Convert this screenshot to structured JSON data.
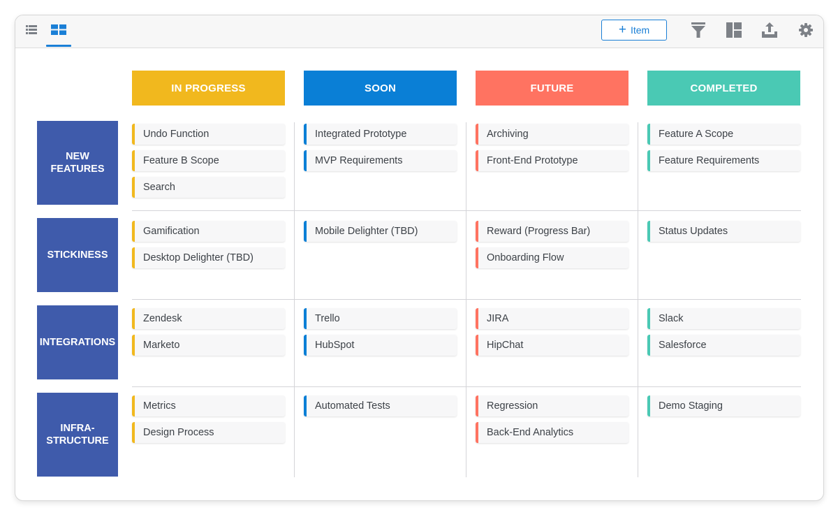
{
  "toolbar": {
    "views": [
      {
        "name": "list-view",
        "icon": "list-icon",
        "active": false
      },
      {
        "name": "board-view",
        "icon": "grid-icon",
        "active": true
      }
    ],
    "add_item_label": "Item",
    "add_item_icon": "plus-icon",
    "actions": [
      {
        "name": "filter",
        "icon": "filter-icon"
      },
      {
        "name": "layout",
        "icon": "layout-icon"
      },
      {
        "name": "export",
        "icon": "upload-icon"
      },
      {
        "name": "settings",
        "icon": "gear-icon"
      }
    ]
  },
  "colors": {
    "in_progress": "#f1b81e",
    "soon": "#0a7fd6",
    "future": "#ff7361",
    "completed": "#4ac9b4",
    "row_label_bg": "#3f5bab",
    "accent": "#1a7fd6"
  },
  "columns": [
    {
      "label": "IN PROGRESS",
      "color": "#f1b81e"
    },
    {
      "label": "SOON",
      "color": "#0a7fd6"
    },
    {
      "label": "FUTURE",
      "color": "#ff7361"
    },
    {
      "label": "COMPLETED",
      "color": "#4ac9b4"
    }
  ],
  "rows": [
    {
      "label": "NEW\nFEATURES",
      "cells": [
        [
          "Undo Function",
          "Feature B Scope",
          "Search"
        ],
        [
          "Integrated Prototype",
          "MVP Requirements"
        ],
        [
          "Archiving",
          "Front-End Prototype"
        ],
        [
          "Feature A Scope",
          "Feature Requirements"
        ]
      ]
    },
    {
      "label": "STICKINESS",
      "cells": [
        [
          "Gamification",
          "Desktop Delighter (TBD)"
        ],
        [
          "Mobile Delighter (TBD)"
        ],
        [
          "Reward (Progress Bar)",
          "Onboarding Flow"
        ],
        [
          "Status Updates"
        ]
      ]
    },
    {
      "label": "INTEGRATIONS",
      "cells": [
        [
          "Zendesk",
          "Marketo"
        ],
        [
          "Trello",
          "HubSpot"
        ],
        [
          "JIRA",
          "HipChat"
        ],
        [
          "Slack",
          "Salesforce"
        ]
      ]
    },
    {
      "label": "INFRA-\nSTRUCTURE",
      "cells": [
        [
          "Metrics",
          "Design Process"
        ],
        [
          "Automated Tests"
        ],
        [
          "Regression",
          "Back-End Analytics"
        ],
        [
          "Demo Staging"
        ]
      ]
    }
  ]
}
